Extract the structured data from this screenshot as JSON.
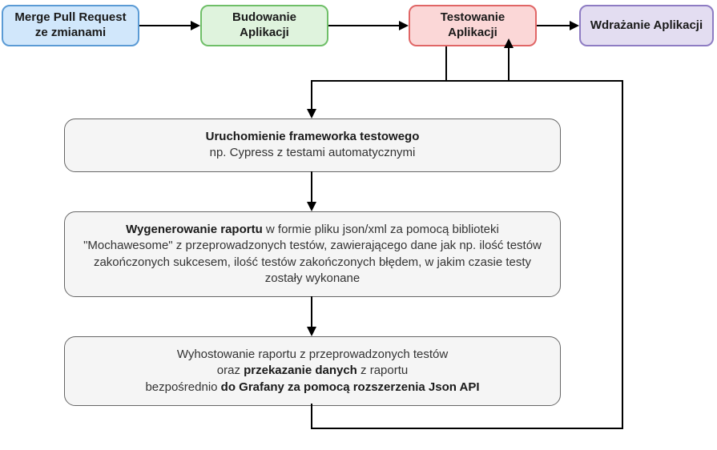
{
  "stages": {
    "merge": {
      "label": "Merge Pull Request ze zmianami",
      "bg": "#d1e7fb",
      "border": "#5b9bd5"
    },
    "build": {
      "label": "Budowanie Aplikacji",
      "bg": "#dff3dd",
      "border": "#6fbf68"
    },
    "test": {
      "label": "Testowanie Aplikacji",
      "bg": "#fbd7d7",
      "border": "#e06666"
    },
    "deploy": {
      "label": "Wdrażanie Aplikacji",
      "bg": "#e3ddf1",
      "border": "#8e7cc3"
    }
  },
  "details": {
    "d1_bold": "Uruchomienie  frameworka testowego",
    "d1_rest": "np. Cypress z testami automatycznymi",
    "d2_bold": "Wygenerowanie raportu",
    "d2_rest": " w formie pliku json/xml za pomocą biblioteki \"Mochawesome\" z przeprowadzonych testów, zawierającego dane jak np. ilość testów zakończonych sukcesem, ilość testów zakończonych błędem, w jakim czasie testy zostały wykonane",
    "d3_pre": "Wyhostowanie raportu z przeprowadzonych testów",
    "d3_b1": "oraz ",
    "d3_b2": "przekazanie danych",
    "d3_mid": " z raportu",
    "d3_pre2": "bezpośrednio ",
    "d3_b3": "do Grafany za pomocą rozszerzenia Json API"
  }
}
